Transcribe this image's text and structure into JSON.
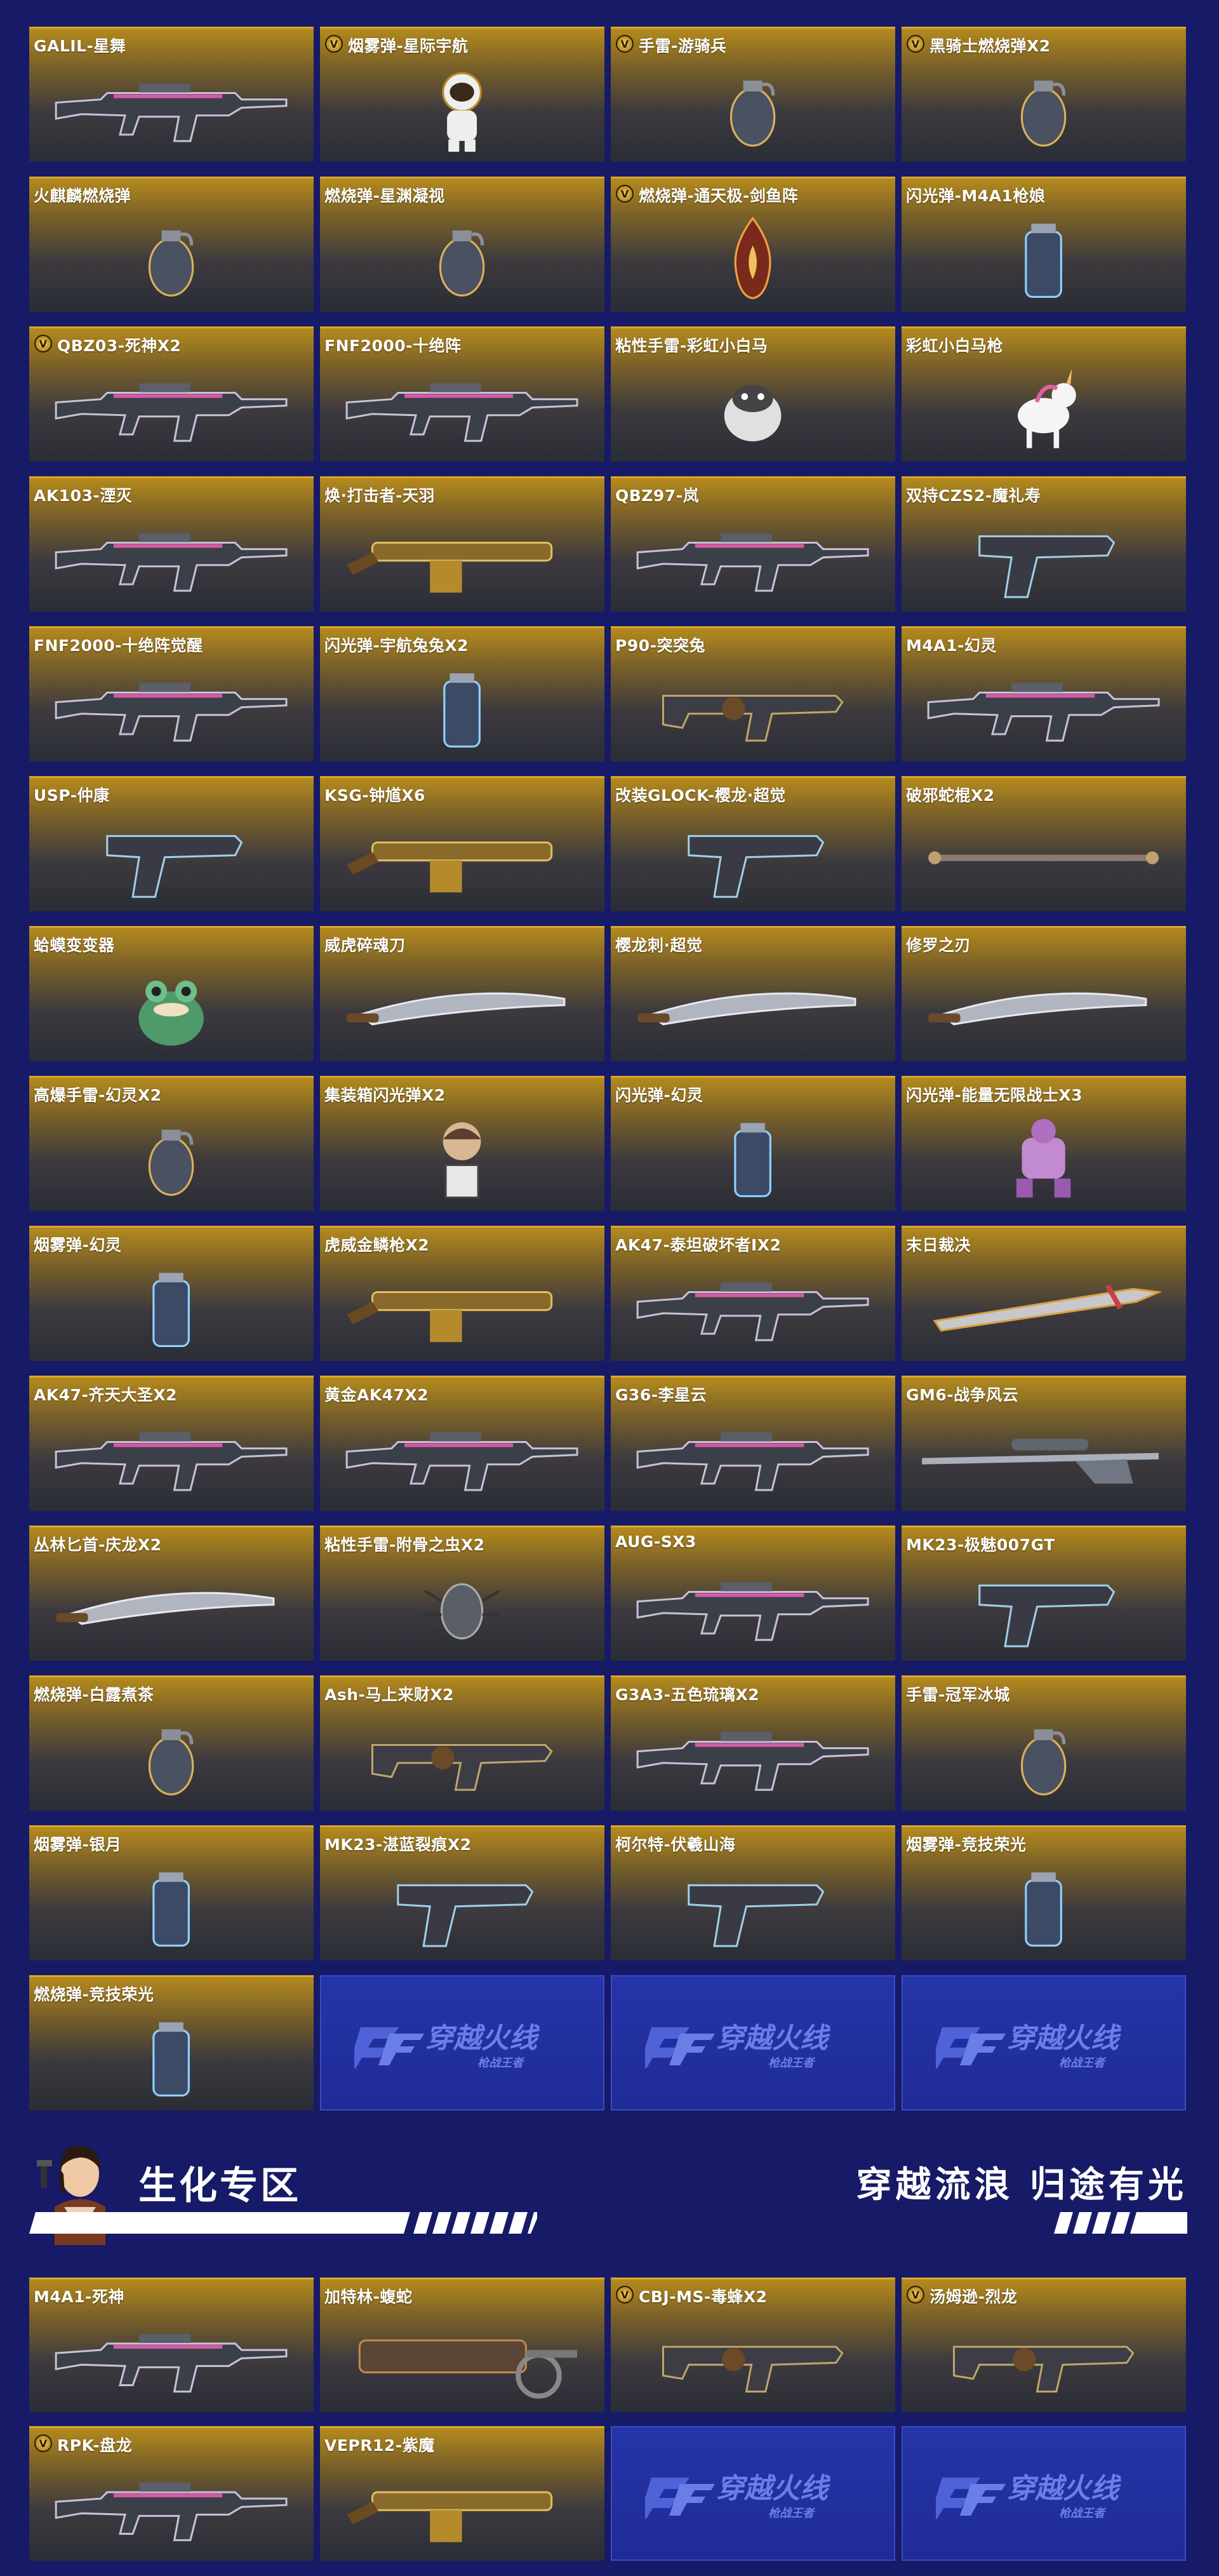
{
  "colors": {
    "background": "#171a66",
    "card_gold": "#b58a1d",
    "card_dark": "#2a2d36",
    "logo_card": "#2534a8"
  },
  "logo": {
    "main": "穿越火线",
    "sub": "枪战王者"
  },
  "grid_items": [
    {
      "name": "GALIL-星舞",
      "vip": false,
      "icon": "rifle-icon"
    },
    {
      "name": "烟雾弹-星际宇航",
      "vip": true,
      "icon": "astronaut-figure-icon"
    },
    {
      "name": "手雷-游骑兵",
      "vip": true,
      "icon": "grenade-icon"
    },
    {
      "name": "黑骑士燃烧弹X2",
      "vip": true,
      "icon": "grenade-icon"
    },
    {
      "name": "火麒麟燃烧弹",
      "vip": false,
      "icon": "grenade-icon"
    },
    {
      "name": "燃烧弹-星渊凝视",
      "vip": false,
      "icon": "grenade-icon"
    },
    {
      "name": "燃烧弹-通天极-剑鱼阵",
      "vip": true,
      "icon": "flame-icon"
    },
    {
      "name": "闪光弹-M4A1枪娘",
      "vip": false,
      "icon": "canister-icon"
    },
    {
      "name": "QBZ03-死神X2",
      "vip": true,
      "icon": "rifle-icon"
    },
    {
      "name": "FNF2000-十绝阵",
      "vip": false,
      "icon": "rifle-icon"
    },
    {
      "name": "粘性手雷-彩虹小白马",
      "vip": false,
      "icon": "creature-icon"
    },
    {
      "name": "彩虹小白马枪",
      "vip": false,
      "icon": "unicorn-icon"
    },
    {
      "name": "AK103-湮灭",
      "vip": false,
      "icon": "rifle-icon"
    },
    {
      "name": "焕·打击者-天羽",
      "vip": false,
      "icon": "shotgun-icon"
    },
    {
      "name": "QBZ97-岚",
      "vip": false,
      "icon": "rifle-icon"
    },
    {
      "name": "双持CZS2-魔礼寿",
      "vip": false,
      "icon": "pistol-icon"
    },
    {
      "name": "FNF2000-十绝阵觉醒",
      "vip": false,
      "icon": "rifle-icon"
    },
    {
      "name": "闪光弹-宇航兔兔X2",
      "vip": false,
      "icon": "canister-icon"
    },
    {
      "name": "P90-突突兔",
      "vip": false,
      "icon": "smg-icon"
    },
    {
      "name": "M4A1-幻灵",
      "vip": false,
      "icon": "rifle-icon"
    },
    {
      "name": "USP-仲康",
      "vip": false,
      "icon": "pistol-icon"
    },
    {
      "name": "KSG-钟馗X6",
      "vip": false,
      "icon": "shotgun-icon"
    },
    {
      "name": "改装GLOCK-樱龙·超觉",
      "vip": false,
      "icon": "pistol-icon"
    },
    {
      "name": "破邪蛇棍X2",
      "vip": false,
      "icon": "staff-icon"
    },
    {
      "name": "蛤蟆变变器",
      "vip": false,
      "icon": "frog-icon"
    },
    {
      "name": "威虎碎魂刀",
      "vip": false,
      "icon": "blade-icon"
    },
    {
      "name": "樱龙刺·超觉",
      "vip": false,
      "icon": "blade-icon"
    },
    {
      "name": "修罗之刃",
      "vip": false,
      "icon": "blade-icon"
    },
    {
      "name": "高爆手雷-幻灵X2",
      "vip": false,
      "icon": "grenade-icon"
    },
    {
      "name": "集装箱闪光弹X2",
      "vip": false,
      "icon": "doll-icon"
    },
    {
      "name": "闪光弹-幻灵",
      "vip": false,
      "icon": "canister-icon"
    },
    {
      "name": "闪光弹-能量无限战士X3",
      "vip": false,
      "icon": "mech-icon"
    },
    {
      "name": "烟雾弹-幻灵",
      "vip": false,
      "icon": "canister-icon"
    },
    {
      "name": "虎威金鳞枪X2",
      "vip": false,
      "icon": "shotgun-icon"
    },
    {
      "name": "AK47-泰坦破坏者ⅠX2",
      "vip": false,
      "icon": "rifle-icon"
    },
    {
      "name": "末日裁决",
      "vip": false,
      "icon": "greatsword-icon"
    },
    {
      "name": "AK47-齐天大圣X2",
      "vip": false,
      "icon": "rifle-icon"
    },
    {
      "name": "黄金AK47X2",
      "vip": false,
      "icon": "rifle-icon"
    },
    {
      "name": "G36-李星云",
      "vip": false,
      "icon": "rifle-icon"
    },
    {
      "name": "GM6-战争风云",
      "vip": false,
      "icon": "sniper-icon"
    },
    {
      "name": "丛林匕首-庆龙X2",
      "vip": false,
      "icon": "blade-icon"
    },
    {
      "name": "粘性手雷-附骨之虫X2",
      "vip": false,
      "icon": "bug-icon"
    },
    {
      "name": "AUG-SX3",
      "vip": false,
      "icon": "rifle-icon"
    },
    {
      "name": "MK23-极魅007GT",
      "vip": false,
      "icon": "pistol-icon"
    },
    {
      "name": "燃烧弹-白露煮茶",
      "vip": false,
      "icon": "grenade-icon"
    },
    {
      "name": "Ash-马上来财X2",
      "vip": false,
      "icon": "smg-icon"
    },
    {
      "name": "G3A3-五色琉璃X2",
      "vip": false,
      "icon": "rifle-icon"
    },
    {
      "name": "手雷-冠军冰城",
      "vip": false,
      "icon": "grenade-icon"
    },
    {
      "name": "烟雾弹-银月",
      "vip": false,
      "icon": "canister-icon"
    },
    {
      "name": "MK23-湛蓝裂痕X2",
      "vip": false,
      "icon": "pistol-icon"
    },
    {
      "name": "柯尔特-伏羲山海",
      "vip": false,
      "icon": "pistol-icon"
    },
    {
      "name": "烟雾弹-竞技荣光",
      "vip": false,
      "icon": "canister-icon"
    },
    {
      "name": "燃烧弹-竞技荣光",
      "vip": false,
      "icon": "canister-icon"
    }
  ],
  "banner": {
    "title": "生化专区",
    "slogan": "穿越流浪 归途有光"
  },
  "bio_items": [
    {
      "name": "M4A1-死神",
      "vip": false,
      "icon": "rifle-icon"
    },
    {
      "name": "加特林-蝮蛇",
      "vip": false,
      "icon": "minigun-icon"
    },
    {
      "name": "CBJ-MS-毒蜂X2",
      "vip": true,
      "icon": "smg-icon"
    },
    {
      "name": "汤姆逊-烈龙",
      "vip": true,
      "icon": "smg-icon"
    },
    {
      "name": "RPK-盘龙",
      "vip": true,
      "icon": "rifle-icon"
    },
    {
      "name": "VEPR12-紫魔",
      "vip": false,
      "icon": "shotgun-icon"
    }
  ]
}
